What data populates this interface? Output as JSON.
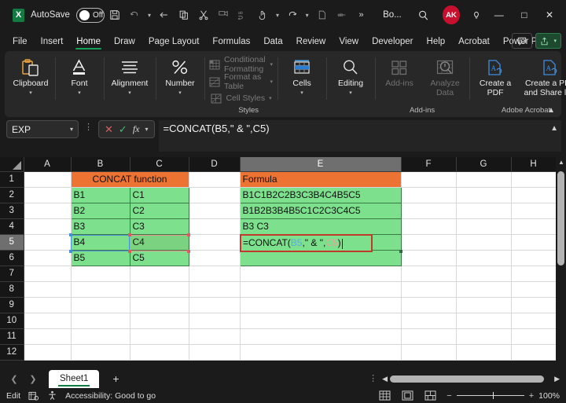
{
  "titlebar": {
    "app_icon": "excel-logo-icon",
    "autosave_label": "AutoSave",
    "autosave_state": "Off",
    "quick_access": [
      {
        "name": "save-icon",
        "glyph": "ὋE",
        "dim": false
      },
      {
        "name": "undo-icon",
        "glyph": "↶",
        "dim": true
      },
      {
        "name": "undo-dropdown-icon",
        "glyph": "⌄",
        "dim": true
      },
      {
        "name": "back-arrow-icon",
        "glyph": "←",
        "dim": false
      },
      {
        "name": "copy-icon",
        "glyph": "copy",
        "dim": false
      },
      {
        "name": "cut-icon",
        "glyph": "scissors",
        "dim": false
      },
      {
        "name": "format-painter-icon",
        "glyph": "brush",
        "dim": true
      },
      {
        "name": "spelling-icon",
        "glyph": "abc",
        "dim": true
      },
      {
        "name": "touch-mode-icon",
        "glyph": "hand",
        "dim": false
      },
      {
        "name": "touch-dropdown-icon",
        "glyph": "⌄",
        "dim": true
      },
      {
        "name": "redo-icon",
        "glyph": "↷",
        "dim": false
      },
      {
        "name": "redo-dropdown-icon",
        "glyph": "⌄",
        "dim": true
      },
      {
        "name": "new-file-icon",
        "glyph": "page",
        "dim": true
      },
      {
        "name": "strikethrough-icon",
        "glyph": "ab",
        "dim": true
      },
      {
        "name": "more-commands-icon",
        "glyph": "»",
        "dim": false
      }
    ],
    "document_name": "Bo...",
    "search_icon": "search-icon",
    "avatar_initials": "AK",
    "help_icon": "lightbulb-icon",
    "minimize": "—",
    "maximize": "□",
    "close": "✕"
  },
  "ribbon_tabs": {
    "items": [
      "File",
      "Insert",
      "Home",
      "Draw",
      "Page Layout",
      "Formulas",
      "Data",
      "Review",
      "View",
      "Developer",
      "Help",
      "Acrobat",
      "Power Pivot"
    ],
    "active": "Home",
    "comments_icon": "comment-icon",
    "share_label": "",
    "share_icon": "share-icon"
  },
  "ribbon": {
    "groups": [
      {
        "name": "clipboard",
        "label": "Clipboard",
        "icon": "clipboard-icon",
        "disabled": false
      },
      {
        "name": "font",
        "label": "Font",
        "icon": "font-icon",
        "disabled": false
      },
      {
        "name": "alignment",
        "label": "Alignment",
        "icon": "alignment-icon",
        "disabled": false
      },
      {
        "name": "number",
        "label": "Number",
        "icon": "percent-icon",
        "disabled": false
      }
    ],
    "styles": {
      "group_label": "Styles",
      "items": [
        {
          "label": "Conditional Formatting",
          "icon": "conditional-formatting-icon",
          "has_chevron": true
        },
        {
          "label": "Format as Table",
          "icon": "format-as-table-icon",
          "has_chevron": true
        },
        {
          "label": "Cell Styles",
          "icon": "cell-styles-icon",
          "has_chevron": true
        }
      ]
    },
    "cells": {
      "label": "Cells",
      "icon": "cells-icon"
    },
    "editing": {
      "label": "Editing",
      "icon": "editing-search-icon"
    },
    "addins": {
      "group_label": "Add-ins",
      "items": [
        {
          "label": "Add-ins",
          "icon": "add-ins-icon",
          "disabled": true
        },
        {
          "label": "Analyze Data",
          "icon": "analyze-data-icon",
          "disabled": true
        }
      ]
    },
    "acrobat": {
      "group_label": "Adobe Acrobat",
      "items": [
        {
          "label": "Create a PDF",
          "icon": "create-pdf-icon"
        },
        {
          "label": "Create a PDF and Share link",
          "icon": "create-pdf-share-icon"
        }
      ]
    },
    "collapse_icon": "chevron-up-icon"
  },
  "formula_bar": {
    "name_box_value": "EXP",
    "name_box_chevron": "chevron-down-icon",
    "cancel_icon": "cancel-x-icon",
    "enter_icon": "confirm-check-icon",
    "function_icon": "fx-icon",
    "function_chevron": "chevron-down-icon",
    "formula": "=CONCAT(B5,\" & \",C5)",
    "expand_icon": "chevron-up-icon"
  },
  "grid": {
    "columns": [
      "A",
      "B",
      "C",
      "D",
      "E",
      "F",
      "G",
      "H"
    ],
    "active_column": "E",
    "rows": [
      "1",
      "2",
      "3",
      "4",
      "5",
      "6",
      "7",
      "8",
      "9",
      "10",
      "11",
      "12"
    ],
    "active_row": "5",
    "cells": {
      "B1": "CONCAT function",
      "E1": "Formula",
      "B2": "B1",
      "C2": "C1",
      "E2": "B1C1B2C2B3C3B4C4B5C5",
      "B3": "B2",
      "C3": "C2",
      "E3": "B1B2B3B4B5C1C2C3C4C5",
      "B4": "B3",
      "C4": "C3",
      "E4": "B3 C3",
      "B5": "B4",
      "C5": "C4",
      "B6": "B5",
      "C6": "C5"
    },
    "editing_cell": {
      "address": "E5",
      "prefix": "=CONCAT(",
      "ref1": "B5",
      "middle": ",\" & \",",
      "ref2": "C5",
      "suffix": ")"
    },
    "colors": {
      "header_orange": "#ec7331",
      "data_green": "#7ce08c",
      "edit_border": "#c0392b",
      "ref1_color": "#5fa8e8",
      "ref2_color": "#e8a19a"
    }
  },
  "sheet_tabs": {
    "prev_icon": "chevron-left-icon",
    "next_icon": "chevron-right-icon",
    "tabs": [
      "Sheet1"
    ],
    "active": "Sheet1",
    "add_icon": "plus-icon",
    "options_icon": "more-vertical-icon",
    "scroll_left_icon": "triangle-left-icon",
    "scroll_right_icon": "triangle-right-icon"
  },
  "status_bar": {
    "mode": "Edit",
    "macro_icon": "record-macro-icon",
    "accessibility_icon": "accessibility-icon",
    "accessibility_text": "Accessibility: Good to go",
    "views": [
      {
        "name": "normal-view-icon"
      },
      {
        "name": "page-layout-view-icon"
      },
      {
        "name": "page-break-view-icon"
      }
    ],
    "zoom_out": "−",
    "zoom_in": "+",
    "zoom_level": "100%"
  }
}
